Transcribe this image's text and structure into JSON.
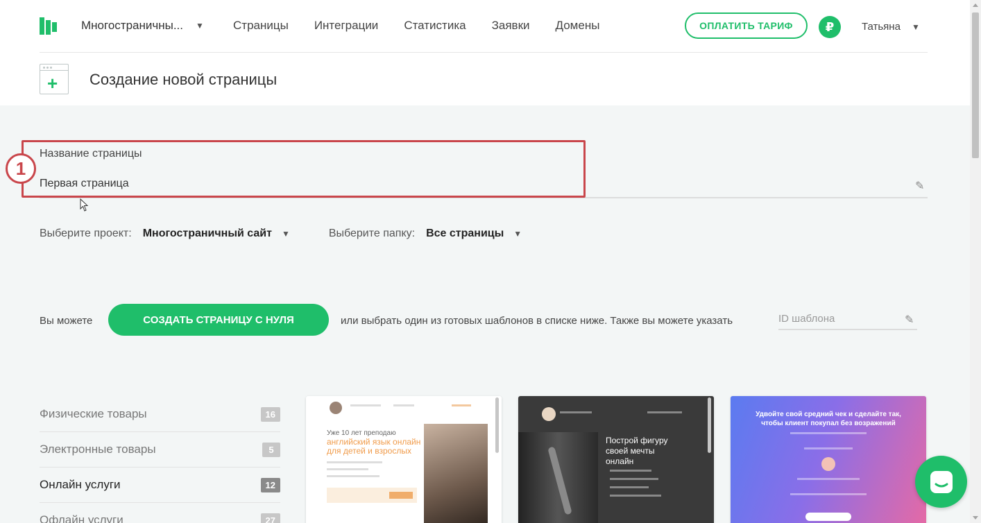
{
  "header": {
    "project_name": "Многостраничны...",
    "menu": [
      "Страницы",
      "Интеграции",
      "Статистика",
      "Заявки",
      "Домены"
    ],
    "pay_button": "ОПЛАТИТЬ ТАРИФ",
    "currency_symbol": "₽",
    "user_name": "Татьяна"
  },
  "page": {
    "title": "Создание новой страницы"
  },
  "form": {
    "name_label": "Название страницы",
    "name_value": "Первая страница",
    "step_number": "1",
    "project_label": "Выберите проект:",
    "project_value": "Многостраничный сайт",
    "folder_label": "Выберите папку:",
    "folder_value": "Все страницы"
  },
  "create": {
    "you_can": "Вы можете",
    "button": "СОЗДАТЬ СТРАНИЦУ С НУЛЯ",
    "or_text": "или выбрать один из готовых шаблонов в списке ниже. Также вы можете указать",
    "template_id_placeholder": "ID шаблона"
  },
  "categories": [
    {
      "label": "Физические товары",
      "count": "16",
      "active": false
    },
    {
      "label": "Электронные товары",
      "count": "5",
      "active": false
    },
    {
      "label": "Онлайн услуги",
      "count": "12",
      "active": true
    },
    {
      "label": "Офлайн услуги",
      "count": "27",
      "active": false
    }
  ],
  "templates": [
    {
      "headline": "Уже 10 лет преподаю",
      "subhead": "английский язык онлайн для детей и взрослых"
    },
    {
      "headline": "Построй фигуру своей мечты онлайн"
    },
    {
      "headline": "Удвойте свой средний чек и сделайте так, чтобы клиент покупал без возражений"
    }
  ],
  "colors": {
    "accent": "#1fbe6a",
    "highlight": "#c9464b"
  }
}
